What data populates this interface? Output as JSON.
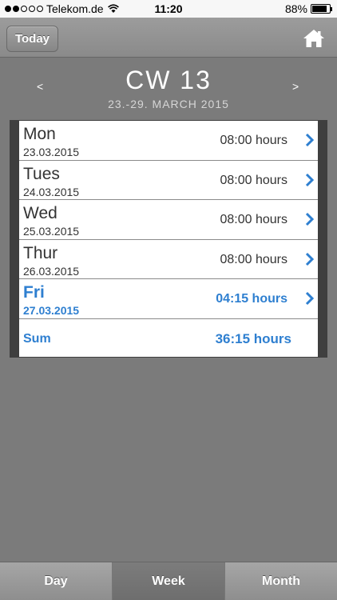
{
  "status_bar": {
    "carrier": "Telekom.de",
    "time": "11:20",
    "battery": "88%",
    "battery_level": 0.88
  },
  "nav": {
    "today_label": "Today",
    "home_icon": "home-icon"
  },
  "week": {
    "title": "CW 13",
    "range": "23.-29. MARCH 2015",
    "prev": "<",
    "next": ">"
  },
  "days": [
    {
      "name": "Mon",
      "date": "23.03.2015",
      "hours": "08:00 hours",
      "active": false
    },
    {
      "name": "Tues",
      "date": "24.03.2015",
      "hours": "08:00 hours",
      "active": false
    },
    {
      "name": "Wed",
      "date": "25.03.2015",
      "hours": "08:00 hours",
      "active": false
    },
    {
      "name": "Thur",
      "date": "26.03.2015",
      "hours": "08:00 hours",
      "active": false
    },
    {
      "name": "Fri",
      "date": "27.03.2015",
      "hours": "04:15 hours",
      "active": true
    }
  ],
  "sum": {
    "label": "Sum",
    "value": "36:15 hours"
  },
  "tabs": [
    {
      "label": "Day",
      "selected": false
    },
    {
      "label": "Week",
      "selected": true
    },
    {
      "label": "Month",
      "selected": false
    }
  ],
  "colors": {
    "accent": "#2e7fd0",
    "background": "#7b7b7b"
  }
}
